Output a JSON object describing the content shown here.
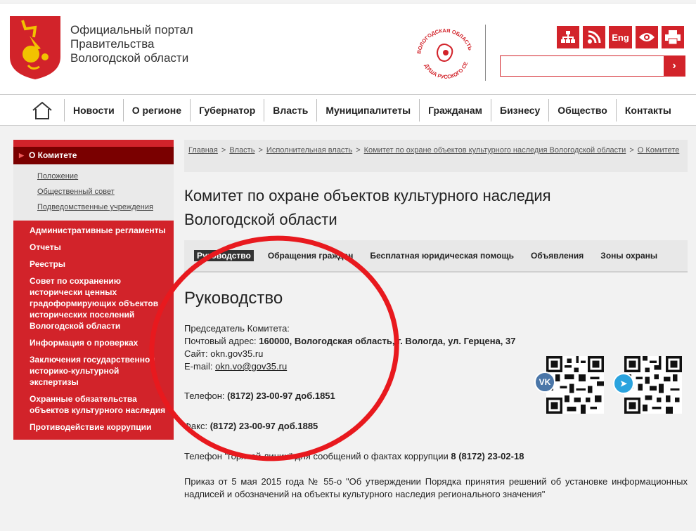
{
  "header": {
    "portal_title_line1": "Официальный портал",
    "portal_title_line2": "Правительства",
    "portal_title_line3": "Вологодской области",
    "seal_text_top": "ВОЛОГОДСКАЯ ОБЛАСТЬ",
    "seal_text_bottom": "ДУША РУССКОГО СЕВЕРА",
    "icons": [
      {
        "name": "sitemap-icon"
      },
      {
        "name": "rss-icon"
      },
      {
        "name": "english-version-icon",
        "label": "Eng"
      },
      {
        "name": "accessibility-eye-icon"
      },
      {
        "name": "print-icon"
      }
    ],
    "search_placeholder": "",
    "search_button": "›"
  },
  "nav": {
    "home_icon": "home-icon",
    "items": [
      "Новости",
      "О регионе",
      "Губернатор",
      "Власть",
      "Муниципалитеты",
      "Гражданам",
      "Бизнесу",
      "Общество",
      "Контакты"
    ]
  },
  "sidebar": {
    "active": "О Комитете",
    "sub_items": [
      "Положение",
      "Общественный совет",
      "Подведомственные учреждения"
    ],
    "items": [
      "Административные регламенты",
      "Отчеты",
      "Реестры",
      "Совет по сохранению исторически ценных градоформирующих объектов исторических поселений Вологодской области",
      "Информация о проверках",
      "Заключения государственной историко-культурной экспертизы",
      "Охранные обязательства объектов культурного наследия",
      "Противодействие коррупции"
    ]
  },
  "breadcrumb": {
    "items": [
      "Главная",
      "Власть",
      "Исполнительная власть",
      "Комитет по охране объектов культурного наследия Вологодской области",
      "О Комитете"
    ],
    "separator": ">"
  },
  "main": {
    "title_line1": "Комитет по охране объектов культурного наследия",
    "title_line2": "Вологодской области",
    "tabs": [
      "Руководство",
      "Обращения граждан",
      "Бесплатная юридическая помощь",
      "Объявления",
      "Зоны охраны"
    ],
    "active_tab": "Руководство",
    "section_title": "Руководство",
    "chairman_label": "Председатель Комитета:",
    "address_label": "Почтовый адрес:",
    "address_value": "160000, Вологодская область, г. Вологда, ул. Герцена, 37",
    "site_label": "Сайт:",
    "site_value": "okn.gov35.ru",
    "email_label": "E-mail:",
    "email_value": "okn.vo@gov35.ru",
    "phone_label": "Телефон:",
    "phone_value": "(8172) 23-00-97 доб.1851",
    "fax_label": "Факс:",
    "fax_value": "(8172) 23-00-97 доб.1885",
    "hotline_text": "Телефон \"горячей линии\" для сообщений о фактах коррупции",
    "hotline_value": "8 (8172) 23-02-18",
    "order_text": "Приказ от 5 мая 2015 года № 55-о \"Об утверждении Порядка принятия решений об установке информационных надписей и обозначений на объекты культурного наследия регионального значения\"",
    "qr_codes": [
      {
        "name": "vk-qr-code",
        "badge": "VK",
        "color": "#4a76a8"
      },
      {
        "name": "telegram-qr-code",
        "badge": "➤",
        "color": "#2aa3de"
      }
    ]
  },
  "colors": {
    "accent_red": "#d2232a",
    "dark_red": "#7a0000",
    "annotation_ring": "#e8191e"
  }
}
